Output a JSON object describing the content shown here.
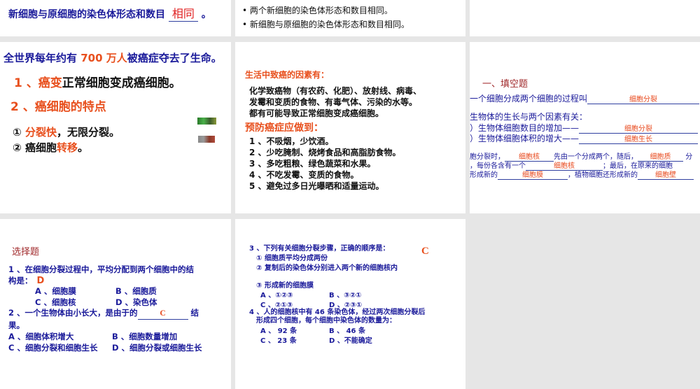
{
  "slide1": {
    "text": "新细胞与原细胞的染色体形态和数目",
    "answer": "相同",
    "end": "。"
  },
  "slide2": {
    "bullets": [
      "两个新细胞的染色体形态和数目相同。",
      "新细胞与原细胞的染色体形态和数目相同。"
    ]
  },
  "slide4": {
    "headline_a": "全世界每年约有",
    "headline_num": "700 万人",
    "headline_b": "被癌症夺去了生命。",
    "item1_label": "1 、癌变",
    "item1_text": "正常细胞变成癌细胞。",
    "item2": "2 、癌细胞的特点",
    "f1_num": "①",
    "f1_red": "分裂快",
    "f1_rest": "，无限分裂。",
    "f2_num": "②",
    "f2_text": "癌细胞",
    "f2_red": "转移",
    "f2_end": "。"
  },
  "slide5": {
    "heading1": "生活中致癌的因素有：",
    "factors": [
      "化学致癌物（有农药、化肥）、放射线、病毒、",
      "发霉和变质的食物、有毒气体、污染的水等。",
      "都有可能导致正常细胞变成癌细胞。"
    ],
    "heading2": "预防癌症应做到：",
    "tips": [
      "1 、不吸烟，少饮酒。",
      "2 、少吃腌制、烧烤食品和高脂肪食物。",
      "3 、多吃粗粮、绿色蔬菜和水果。",
      "4 、不吃发霉、变质的食物。",
      "5 、避免过多日光曝晒和适量运动。"
    ]
  },
  "slide6": {
    "title": "一、填空题",
    "q1": "一个细胞分成两个细胞的过程叫",
    "a1": "细胞分裂",
    "q2": "生物体的生长与两个因素有关：",
    "q2a": "）生物体细胞数目的增加——",
    "a2a": "细胞分裂",
    "q2b": "）生物体细胞体积的增大——",
    "a2b": "细胞生长",
    "q3a": "胞分裂时，",
    "a3a": "细胞核",
    "q3b": "先由一个分成两个，随后，",
    "a3b": "细胞质",
    "q3c": "分",
    "q3d": "，每份各含有一个",
    "a3c": "细胞核",
    "q3e": "；最后，在原来的细胞",
    "q3f": "形成新的",
    "a3d": "细胞膜",
    "q3g": "，植物细胞还形成新的",
    "a3e": "细胞壁"
  },
  "slide7": {
    "title": "选择题",
    "q1a": "1 、在细胞分裂过程中，平均分配到两个细胞中的结",
    "q1b": "构是：",
    "a1": "D",
    "q1_opts": [
      "A 、细胞膜",
      "B 、细胞质",
      "C 、细胞核",
      "D 、染色体"
    ],
    "q2a": "2 、一个生物体由小长大，是由于的",
    "a2": "C",
    "q2b": "结",
    "q2c": "果。",
    "q2_opts": [
      "A 、细胞体积增大",
      "B 、细胞数量增加",
      "C 、细胞分裂和细胞生长",
      "D 、细胞分裂或细胞生长"
    ]
  },
  "slide8": {
    "q3": "3 、下列有关细胞分裂步骤，正确的顺序是：",
    "a3": "C",
    "steps": [
      "① 细胞质平均分成两份",
      "② 复制后的染色体分别进入两个新的细胞核内",
      "③ 形成新的细胞膜"
    ],
    "q3_opts": [
      "A 、①②③",
      "B 、③②①",
      "C 、②①③",
      "D 、②③①"
    ],
    "q4a": "4 、人的细胞核中有 46 条染色体，经过两次细胞分裂后",
    "q4b": "形成四个细胞，每个细胞中染色体的数量为：",
    "q4_opts": [
      "A 、 92 条",
      "B 、 46 条",
      "C 、 23 条",
      "D 、不能确定"
    ]
  }
}
